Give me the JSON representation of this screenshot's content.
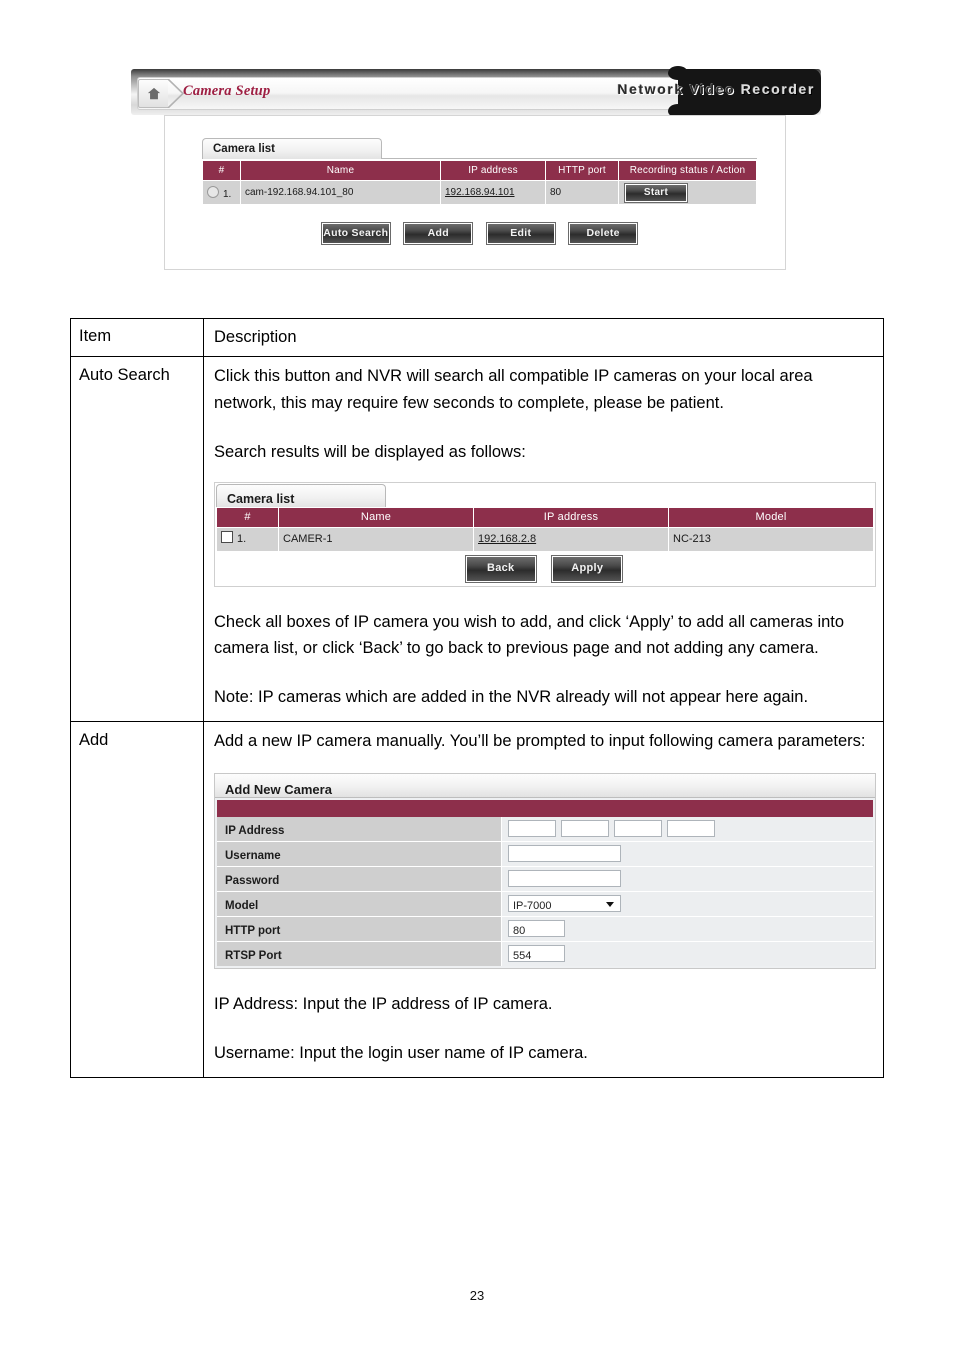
{
  "screenshot_top": {
    "breadcrumb": "Camera Setup",
    "home_icon": "home-icon",
    "logo_part1": "Network ",
    "logo_part2": "Video ",
    "logo_part3": "Recorder",
    "panel_title": "Camera list",
    "columns": [
      "#",
      "Name",
      "IP address",
      "HTTP port",
      "Recording status / Action"
    ],
    "rows": [
      {
        "index": "1.",
        "name": "cam-192.168.94.101_80",
        "ip": "192.168.94.101",
        "http_port": "80",
        "action": "Start"
      }
    ],
    "buttons": [
      "Auto Search",
      "Add",
      "Edit",
      "Delete"
    ]
  },
  "doc_table": {
    "header": {
      "item": "Item",
      "description": "Description"
    },
    "rows": [
      {
        "item": "Auto Search",
        "para1": "Click this button and NVR will search all compatible IP cameras on your local area network, this may require few seconds to complete, please be patient.",
        "para2": "Search results will be displayed as follows:",
        "para3": "Check all boxes of IP camera you wish to add, and click ‘Apply’ to add all cameras into camera list, or click ‘Back’ to go back to previous page and not adding any camera.",
        "para4": "Note: IP cameras which are added in the NVR already will not appear here again."
      },
      {
        "item": "Add",
        "para1": "Add a new IP camera manually. You’ll be prompted to input following camera parameters:",
        "para2": "IP Address: Input the IP address of IP camera.",
        "para3": "Username: Input the login user name of IP camera."
      }
    ]
  },
  "screenshot_search": {
    "panel_title": "Camera list",
    "columns": [
      "#",
      "Name",
      "IP address",
      "Model"
    ],
    "rows": [
      {
        "index": "1.",
        "name": "CAMER-1",
        "ip": "192.168.2.8",
        "model": "NC-213"
      }
    ],
    "buttons": [
      "Back",
      "Apply"
    ]
  },
  "screenshot_addcamera": {
    "panel_title": "Add New Camera",
    "fields": [
      {
        "label": "IP Address",
        "type": "octets",
        "values": [
          "",
          "",
          "",
          ""
        ]
      },
      {
        "label": "Username",
        "type": "text",
        "value": ""
      },
      {
        "label": "Password",
        "type": "text",
        "value": ""
      },
      {
        "label": "Model",
        "type": "select",
        "value": "IP-7000"
      },
      {
        "label": "HTTP port",
        "type": "text",
        "value": "80"
      },
      {
        "label": "RTSP Port",
        "type": "text",
        "value": "554"
      }
    ]
  },
  "footer": {
    "page_number": "23"
  },
  "colors": {
    "accent_maroon": "#8d2f4b",
    "crumb_red": "#9e1f43",
    "row_gray": "#d2d2d2",
    "label_gray": "#cfcfcf"
  }
}
